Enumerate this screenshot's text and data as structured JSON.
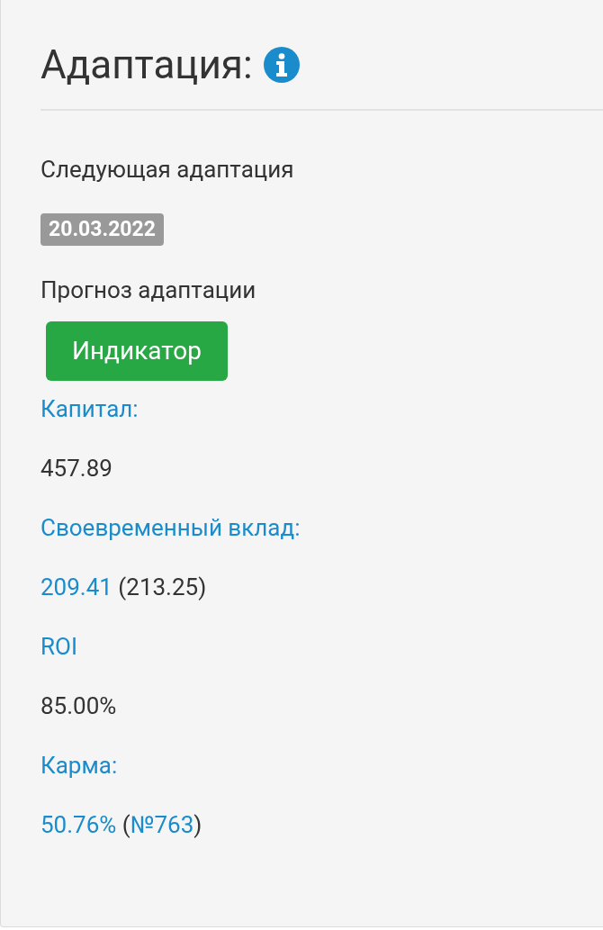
{
  "title": "Адаптация:",
  "next_label": "Следующая адаптация",
  "next_date": "20.03.2022",
  "forecast_label": "Прогноз адаптации",
  "indicator_button": "Индикатор",
  "fields": [
    {
      "label": "Капитал:",
      "value": [
        {
          "text": "457.89",
          "kind": "plain"
        }
      ]
    },
    {
      "label": "Своевременный вклад:",
      "value": [
        {
          "text": "209.41",
          "kind": "link"
        },
        {
          "text": " (213.25)",
          "kind": "plain"
        }
      ]
    },
    {
      "label": "ROI",
      "value": [
        {
          "text": "85.00%",
          "kind": "plain"
        }
      ]
    },
    {
      "label": "Карма:",
      "value": [
        {
          "text": "50.76%",
          "kind": "link"
        },
        {
          "text": " (",
          "kind": "plain"
        },
        {
          "text": "№763",
          "kind": "link"
        },
        {
          "text": ")",
          "kind": "plain"
        }
      ]
    }
  ]
}
